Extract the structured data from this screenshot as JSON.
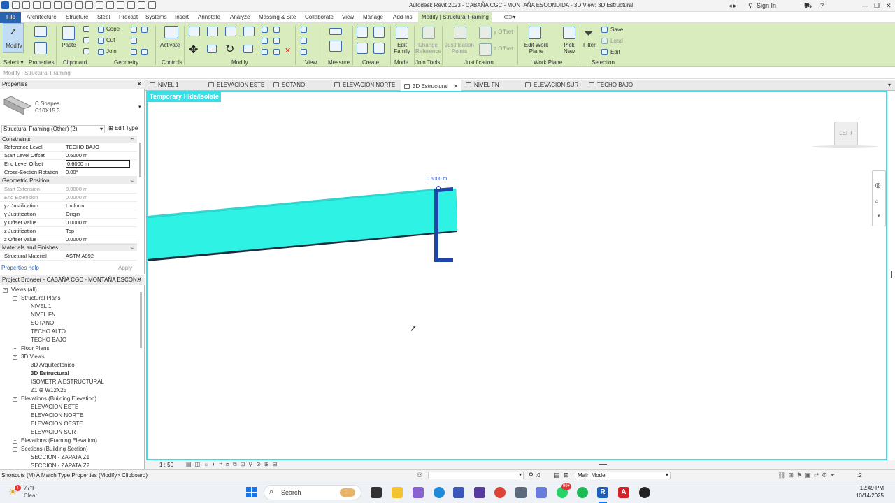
{
  "titlebar": {
    "title": "Autodesk Revit 2023 - CABAÑA CGC - MONTAÑA ESCONDIDA - 3D View: 3D Estructural",
    "sign_in": "Sign In"
  },
  "menu": [
    "File",
    "Architecture",
    "Structure",
    "Steel",
    "Precast",
    "Systems",
    "Insert",
    "Annotate",
    "Analyze",
    "Massing & Site",
    "Collaborate",
    "View",
    "Manage",
    "Add-Ins",
    "Modify | Structural Framing"
  ],
  "ribbon": {
    "select_label": "Select ▾",
    "modify": "Modify",
    "paste": "Paste",
    "properties": "Properties",
    "clipboard": "Clipboard",
    "geometry": "Geometry",
    "controls": "Controls",
    "activate": "Activate",
    "cope": "Cope",
    "cut": "Cut",
    "join": "Join",
    "modify_panel": "Modify",
    "view_panel": "View",
    "measure": "Measure",
    "create": "Create",
    "edit_family": "Edit Family",
    "mode": "Mode",
    "change_reference": "Change Reference",
    "join_tools": "Join Tools",
    "justification_points": "Justification Points",
    "y_offset": "y Offset",
    "z_offset": "z Offset",
    "justification": "Justification",
    "edit_work_plane": "Edit Work Plane",
    "work_plane": "Work Plane",
    "pick_new": "Pick New",
    "filter": "Filter",
    "save": "Save",
    "load": "Load",
    "edit": "Edit",
    "selection": "Selection"
  },
  "context_bar": "Modify | Structural Framing",
  "view_tabs": [
    "NIVEL 1",
    "ELEVACION ESTE",
    "SOTANO",
    "ELEVACION NORTE",
    "3D Estructural",
    "NIVEL FN",
    "ELEVACION SUR",
    "TECHO BAJO"
  ],
  "properties": {
    "header": "Properties",
    "family": "C Shapes",
    "type": "C10X15.3",
    "selector": "Structural Framing (Other) (2)",
    "edit_type": "Edit Type",
    "sections": [
      "Constraints",
      "Geometric Position",
      "Materials and Finishes"
    ],
    "rows": [
      {
        "k": "Reference Level",
        "v": "TECHO BAJO"
      },
      {
        "k": "Start Level Offset",
        "v": "0.6000 m"
      },
      {
        "k": "End Level Offset",
        "v": "0.6000 m"
      },
      {
        "k": "Cross-Section Rotation",
        "v": "0.00°"
      },
      {
        "k": "Start Extension",
        "v": "0.0000 m"
      },
      {
        "k": "End Extension",
        "v": "0.0000 m"
      },
      {
        "k": "yz Justification",
        "v": "Uniform"
      },
      {
        "k": "y Justification",
        "v": "Origin"
      },
      {
        "k": "y Offset Value",
        "v": "0.0000 m"
      },
      {
        "k": "z Justification",
        "v": "Top"
      },
      {
        "k": "z Offset Value",
        "v": "0.0000 m"
      },
      {
        "k": "Structural Material",
        "v": "ASTM A992"
      }
    ],
    "help": "Properties help",
    "apply": "Apply"
  },
  "browser": {
    "header": "Project Browser - CABAÑA CGC - MONTAÑA ESCON...",
    "nodes": [
      "Views (all)",
      "Structural Plans",
      "NIVEL 1",
      "NIVEL FN",
      "SOTANO",
      "TECHO ALTO",
      "TECHO BAJO",
      "Floor Plans",
      "3D Views",
      "3D Arquitectónico",
      "3D Estructural",
      "ISOMETRIA ESTRUCTURAL",
      "Z1 ⊕ W12X25",
      "Elevations (Building Elevation)",
      "ELEVACION ESTE",
      "ELEVACION NORTE",
      "ELEVACION OESTE",
      "ELEVACION SUR",
      "Elevations (Framing Elevation)",
      "Sections (Building Section)",
      "SECCION - ZAPATA Z1",
      "SECCION - ZAPATA Z2"
    ]
  },
  "canvas": {
    "badge": "Temporary Hide/Isolate",
    "dimension": "0.6000 m",
    "viewcube": "LEFT",
    "scale": "1 : 50"
  },
  "status": {
    "hint": "Shortcuts (M) A Match Type Properties (Modify> Clipboard)",
    "selection_count": ":0",
    "model": "Main Model",
    "filter_count": ":2"
  },
  "taskbar": {
    "temp": "77°F",
    "weather": "Clear",
    "search": "Search",
    "time": "12:49 PM",
    "date": "10/14/2025",
    "badge": "99+"
  },
  "colors": {
    "ribbon": "#d8ecbd",
    "accent": "#2a63b0",
    "beam": "#2ef2e3",
    "isolate": "#35e0e6",
    "profile": "#1e44a8"
  }
}
